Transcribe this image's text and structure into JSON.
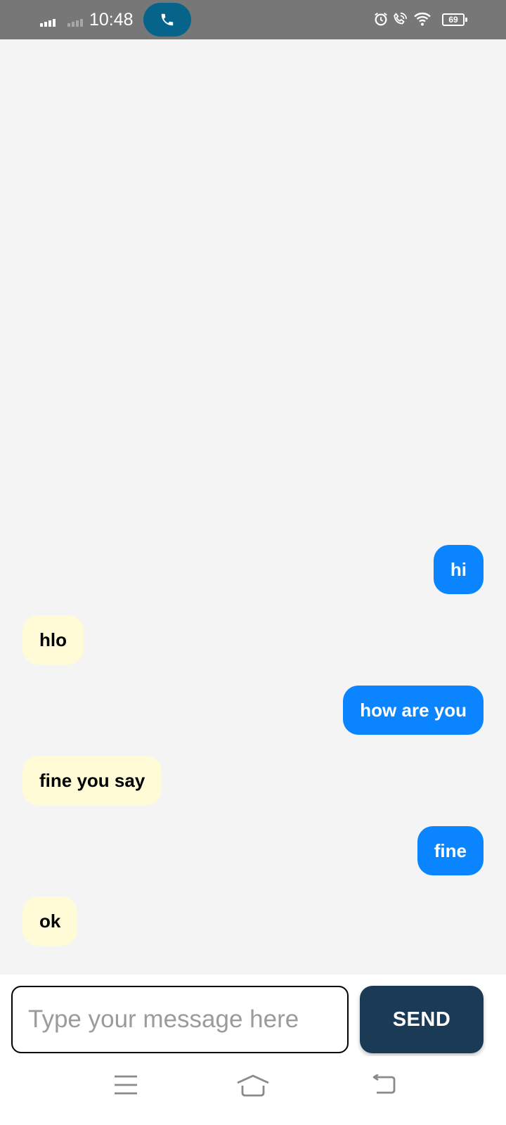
{
  "status_bar": {
    "time": "10:48",
    "battery_level": "69",
    "icons": [
      "signal-icon",
      "signal-icon",
      "phone-icon",
      "alarm-icon",
      "wifi-calling-icon",
      "wifi-icon",
      "battery-icon"
    ]
  },
  "messages": [
    {
      "direction": "outgoing",
      "text": "hi"
    },
    {
      "direction": "incoming",
      "text": "hlo"
    },
    {
      "direction": "outgoing",
      "text": "how are you"
    },
    {
      "direction": "incoming",
      "text": "fine you say"
    },
    {
      "direction": "outgoing",
      "text": "fine"
    },
    {
      "direction": "incoming",
      "text": "ok"
    }
  ],
  "input": {
    "value": "",
    "placeholder": "Type your message here"
  },
  "send_button": {
    "label": "SEND"
  },
  "navigation": {
    "icons": [
      "menu-icon",
      "home-icon",
      "back-icon"
    ]
  },
  "colors": {
    "status_bar": "#777777",
    "call_pill": "#06648a",
    "chat_background": "#f4f4f5",
    "outgoing_bubble": "#0a84ff",
    "incoming_bubble": "#fefbd6",
    "send_button": "#1b3a56"
  }
}
